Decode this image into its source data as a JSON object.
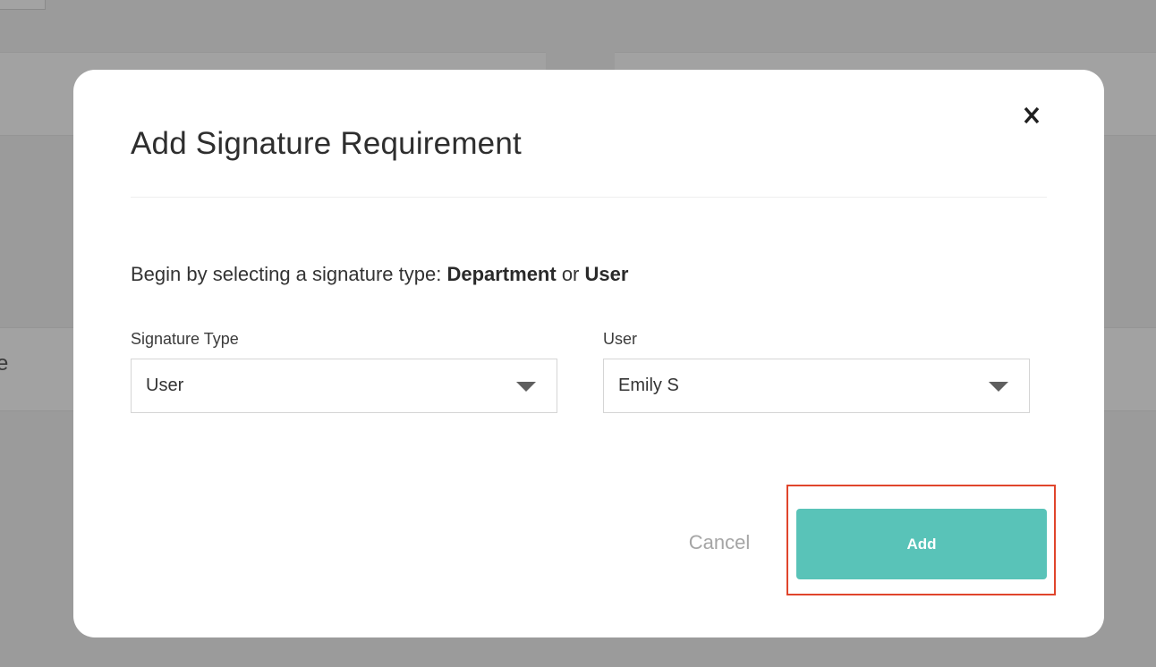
{
  "background": {
    "partial_text": "e"
  },
  "modal": {
    "title": "Add Signature Requirement",
    "close_label": "X",
    "instruction": {
      "prefix": "Begin by selecting a signature type: ",
      "option_1": "Department",
      "joiner": " or ",
      "option_2": "User"
    },
    "signature_type": {
      "label": "Signature Type",
      "selected": "User"
    },
    "user": {
      "label": "User",
      "selected": "Emily S"
    },
    "cancel_label": "Cancel",
    "add_label": "Add"
  },
  "colors": {
    "overlay": "#9b9b9b",
    "modal_background": "#ffffff",
    "primary_button": "#59c3b8",
    "highlight_outline": "#e0452c",
    "cancel_text": "#a5a5a5"
  },
  "icons": {
    "close": "close-icon",
    "dropdown": "chevron-down-icon"
  }
}
